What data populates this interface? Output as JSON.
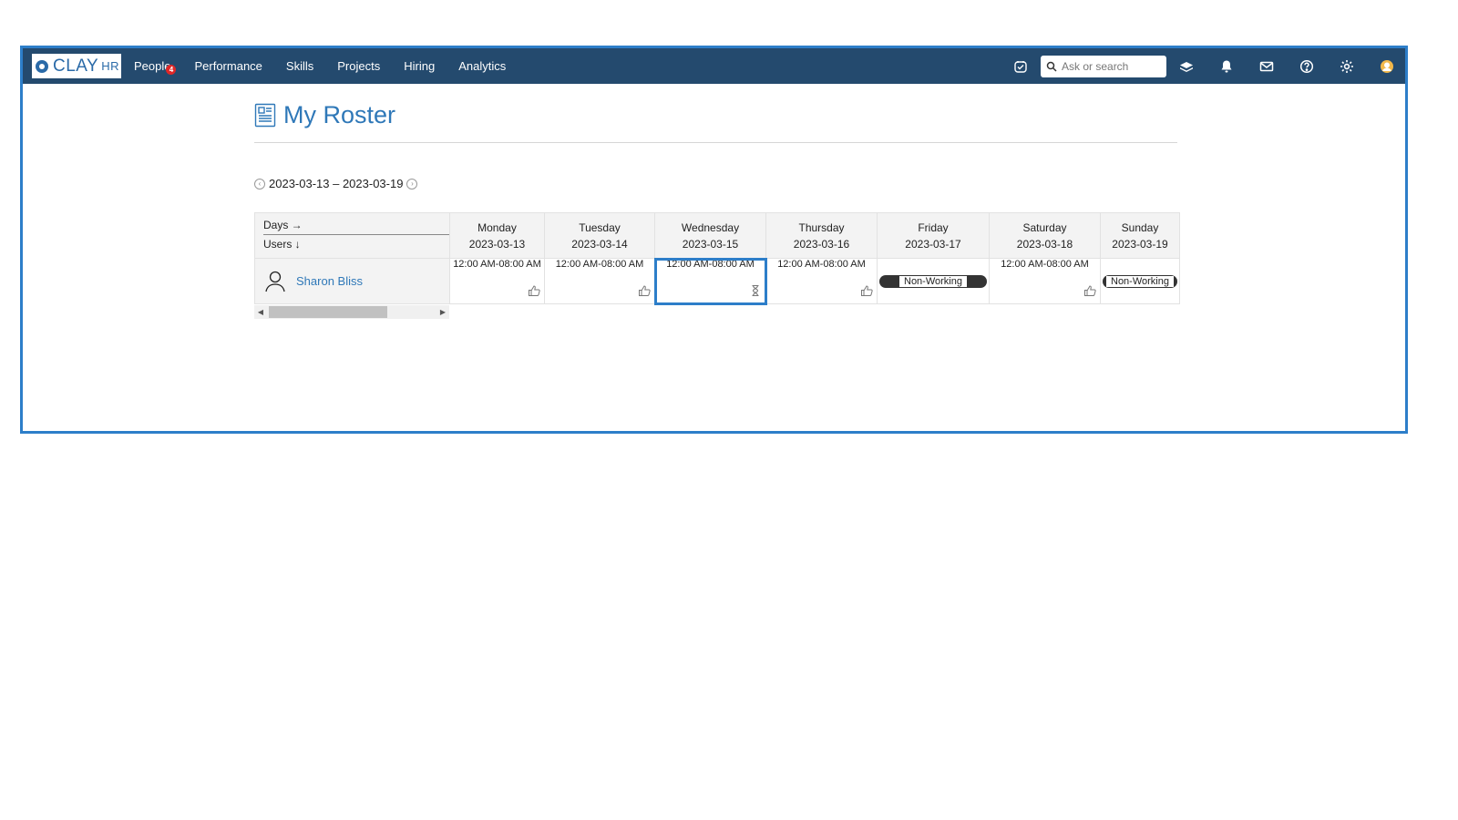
{
  "brand": {
    "name": "CLAY",
    "suffix": "HR"
  },
  "nav": {
    "items": [
      {
        "label": "People",
        "badge": "4"
      },
      {
        "label": "Performance"
      },
      {
        "label": "Skills"
      },
      {
        "label": "Projects"
      },
      {
        "label": "Hiring"
      },
      {
        "label": "Analytics"
      }
    ],
    "search_placeholder": "Ask or search",
    "icons": [
      "task-icon",
      "search-icon",
      "learning-icon",
      "bell-icon",
      "mail-icon",
      "help-icon",
      "gear-icon",
      "avatar-icon"
    ]
  },
  "page": {
    "title": "My Roster",
    "week_range": "2023-03-13 – 2023-03-19"
  },
  "roster": {
    "corner_days": "Days →",
    "corner_users": "Users ↓",
    "days": [
      {
        "name": "Monday",
        "date": "2023-03-13"
      },
      {
        "name": "Tuesday",
        "date": "2023-03-14"
      },
      {
        "name": "Wednesday",
        "date": "2023-03-15"
      },
      {
        "name": "Thursday",
        "date": "2023-03-16"
      },
      {
        "name": "Friday",
        "date": "2023-03-17"
      },
      {
        "name": "Saturday",
        "date": "2023-03-18"
      },
      {
        "name": "Sunday",
        "date": "2023-03-19"
      }
    ],
    "user": {
      "name": "Sharon Bliss",
      "cells": [
        {
          "text": "12:00 AM-08:00 AM",
          "status": "approved-icon"
        },
        {
          "text": "12:00 AM-08:00 AM",
          "status": "approved-icon"
        },
        {
          "text": "12:00 AM-08:00 AM",
          "status": "pending-icon"
        },
        {
          "text": "12:00 AM-08:00 AM",
          "status": "approved-icon"
        },
        {
          "text": "Non-Working"
        },
        {
          "text": "12:00 AM-08:00 AM",
          "status": "approved-icon"
        },
        {
          "text": "Non-Working"
        }
      ]
    }
  },
  "colors": {
    "navbar": "#244a6e",
    "accent": "#2d7ec9",
    "link": "#2f78b8",
    "badge": "#e02727"
  }
}
